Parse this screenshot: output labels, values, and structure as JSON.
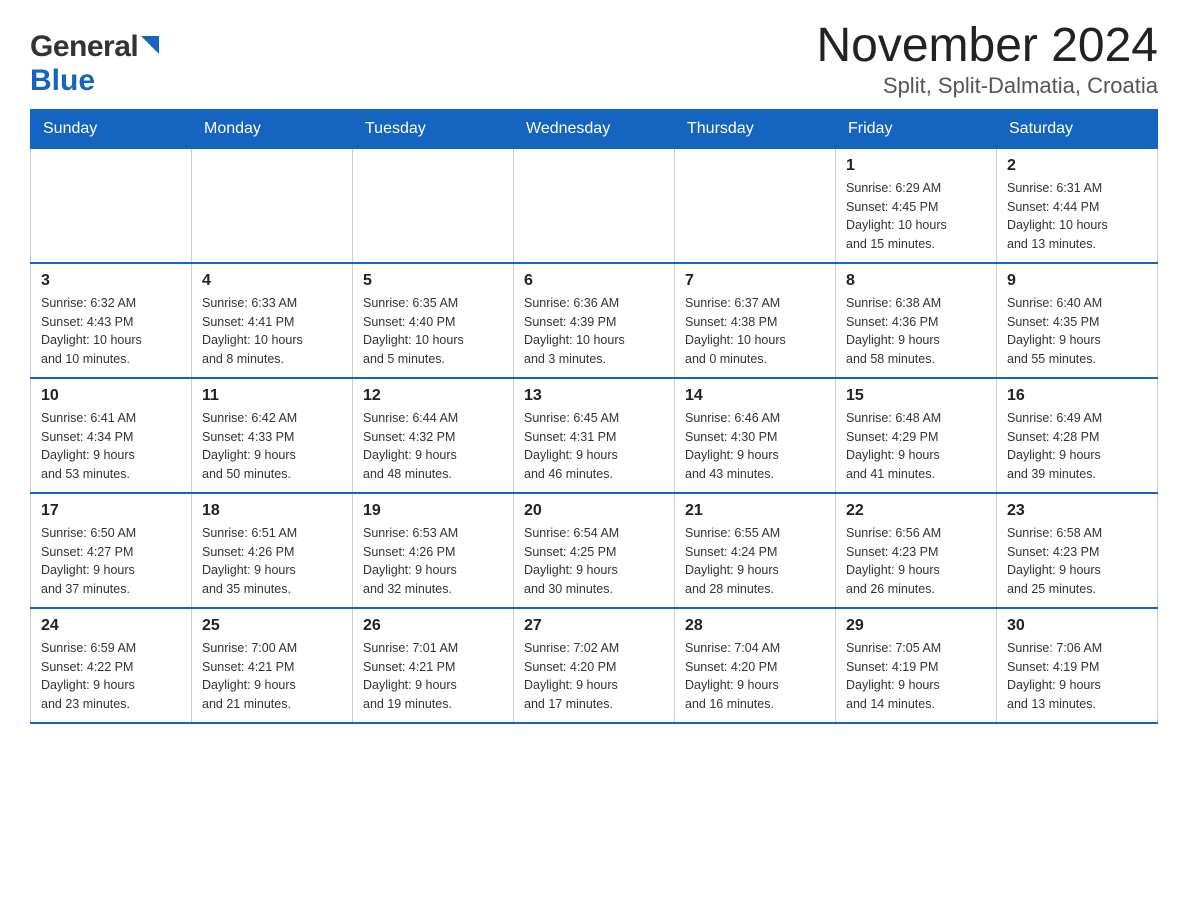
{
  "header": {
    "logo_general": "General",
    "logo_blue": "Blue",
    "title": "November 2024",
    "subtitle": "Split, Split-Dalmatia, Croatia"
  },
  "days_of_week": [
    "Sunday",
    "Monday",
    "Tuesday",
    "Wednesday",
    "Thursday",
    "Friday",
    "Saturday"
  ],
  "weeks": [
    [
      {
        "day": "",
        "info": ""
      },
      {
        "day": "",
        "info": ""
      },
      {
        "day": "",
        "info": ""
      },
      {
        "day": "",
        "info": ""
      },
      {
        "day": "",
        "info": ""
      },
      {
        "day": "1",
        "info": "Sunrise: 6:29 AM\nSunset: 4:45 PM\nDaylight: 10 hours\nand 15 minutes."
      },
      {
        "day": "2",
        "info": "Sunrise: 6:31 AM\nSunset: 4:44 PM\nDaylight: 10 hours\nand 13 minutes."
      }
    ],
    [
      {
        "day": "3",
        "info": "Sunrise: 6:32 AM\nSunset: 4:43 PM\nDaylight: 10 hours\nand 10 minutes."
      },
      {
        "day": "4",
        "info": "Sunrise: 6:33 AM\nSunset: 4:41 PM\nDaylight: 10 hours\nand 8 minutes."
      },
      {
        "day": "5",
        "info": "Sunrise: 6:35 AM\nSunset: 4:40 PM\nDaylight: 10 hours\nand 5 minutes."
      },
      {
        "day": "6",
        "info": "Sunrise: 6:36 AM\nSunset: 4:39 PM\nDaylight: 10 hours\nand 3 minutes."
      },
      {
        "day": "7",
        "info": "Sunrise: 6:37 AM\nSunset: 4:38 PM\nDaylight: 10 hours\nand 0 minutes."
      },
      {
        "day": "8",
        "info": "Sunrise: 6:38 AM\nSunset: 4:36 PM\nDaylight: 9 hours\nand 58 minutes."
      },
      {
        "day": "9",
        "info": "Sunrise: 6:40 AM\nSunset: 4:35 PM\nDaylight: 9 hours\nand 55 minutes."
      }
    ],
    [
      {
        "day": "10",
        "info": "Sunrise: 6:41 AM\nSunset: 4:34 PM\nDaylight: 9 hours\nand 53 minutes."
      },
      {
        "day": "11",
        "info": "Sunrise: 6:42 AM\nSunset: 4:33 PM\nDaylight: 9 hours\nand 50 minutes."
      },
      {
        "day": "12",
        "info": "Sunrise: 6:44 AM\nSunset: 4:32 PM\nDaylight: 9 hours\nand 48 minutes."
      },
      {
        "day": "13",
        "info": "Sunrise: 6:45 AM\nSunset: 4:31 PM\nDaylight: 9 hours\nand 46 minutes."
      },
      {
        "day": "14",
        "info": "Sunrise: 6:46 AM\nSunset: 4:30 PM\nDaylight: 9 hours\nand 43 minutes."
      },
      {
        "day": "15",
        "info": "Sunrise: 6:48 AM\nSunset: 4:29 PM\nDaylight: 9 hours\nand 41 minutes."
      },
      {
        "day": "16",
        "info": "Sunrise: 6:49 AM\nSunset: 4:28 PM\nDaylight: 9 hours\nand 39 minutes."
      }
    ],
    [
      {
        "day": "17",
        "info": "Sunrise: 6:50 AM\nSunset: 4:27 PM\nDaylight: 9 hours\nand 37 minutes."
      },
      {
        "day": "18",
        "info": "Sunrise: 6:51 AM\nSunset: 4:26 PM\nDaylight: 9 hours\nand 35 minutes."
      },
      {
        "day": "19",
        "info": "Sunrise: 6:53 AM\nSunset: 4:26 PM\nDaylight: 9 hours\nand 32 minutes."
      },
      {
        "day": "20",
        "info": "Sunrise: 6:54 AM\nSunset: 4:25 PM\nDaylight: 9 hours\nand 30 minutes."
      },
      {
        "day": "21",
        "info": "Sunrise: 6:55 AM\nSunset: 4:24 PM\nDaylight: 9 hours\nand 28 minutes."
      },
      {
        "day": "22",
        "info": "Sunrise: 6:56 AM\nSunset: 4:23 PM\nDaylight: 9 hours\nand 26 minutes."
      },
      {
        "day": "23",
        "info": "Sunrise: 6:58 AM\nSunset: 4:23 PM\nDaylight: 9 hours\nand 25 minutes."
      }
    ],
    [
      {
        "day": "24",
        "info": "Sunrise: 6:59 AM\nSunset: 4:22 PM\nDaylight: 9 hours\nand 23 minutes."
      },
      {
        "day": "25",
        "info": "Sunrise: 7:00 AM\nSunset: 4:21 PM\nDaylight: 9 hours\nand 21 minutes."
      },
      {
        "day": "26",
        "info": "Sunrise: 7:01 AM\nSunset: 4:21 PM\nDaylight: 9 hours\nand 19 minutes."
      },
      {
        "day": "27",
        "info": "Sunrise: 7:02 AM\nSunset: 4:20 PM\nDaylight: 9 hours\nand 17 minutes."
      },
      {
        "day": "28",
        "info": "Sunrise: 7:04 AM\nSunset: 4:20 PM\nDaylight: 9 hours\nand 16 minutes."
      },
      {
        "day": "29",
        "info": "Sunrise: 7:05 AM\nSunset: 4:19 PM\nDaylight: 9 hours\nand 14 minutes."
      },
      {
        "day": "30",
        "info": "Sunrise: 7:06 AM\nSunset: 4:19 PM\nDaylight: 9 hours\nand 13 minutes."
      }
    ]
  ]
}
